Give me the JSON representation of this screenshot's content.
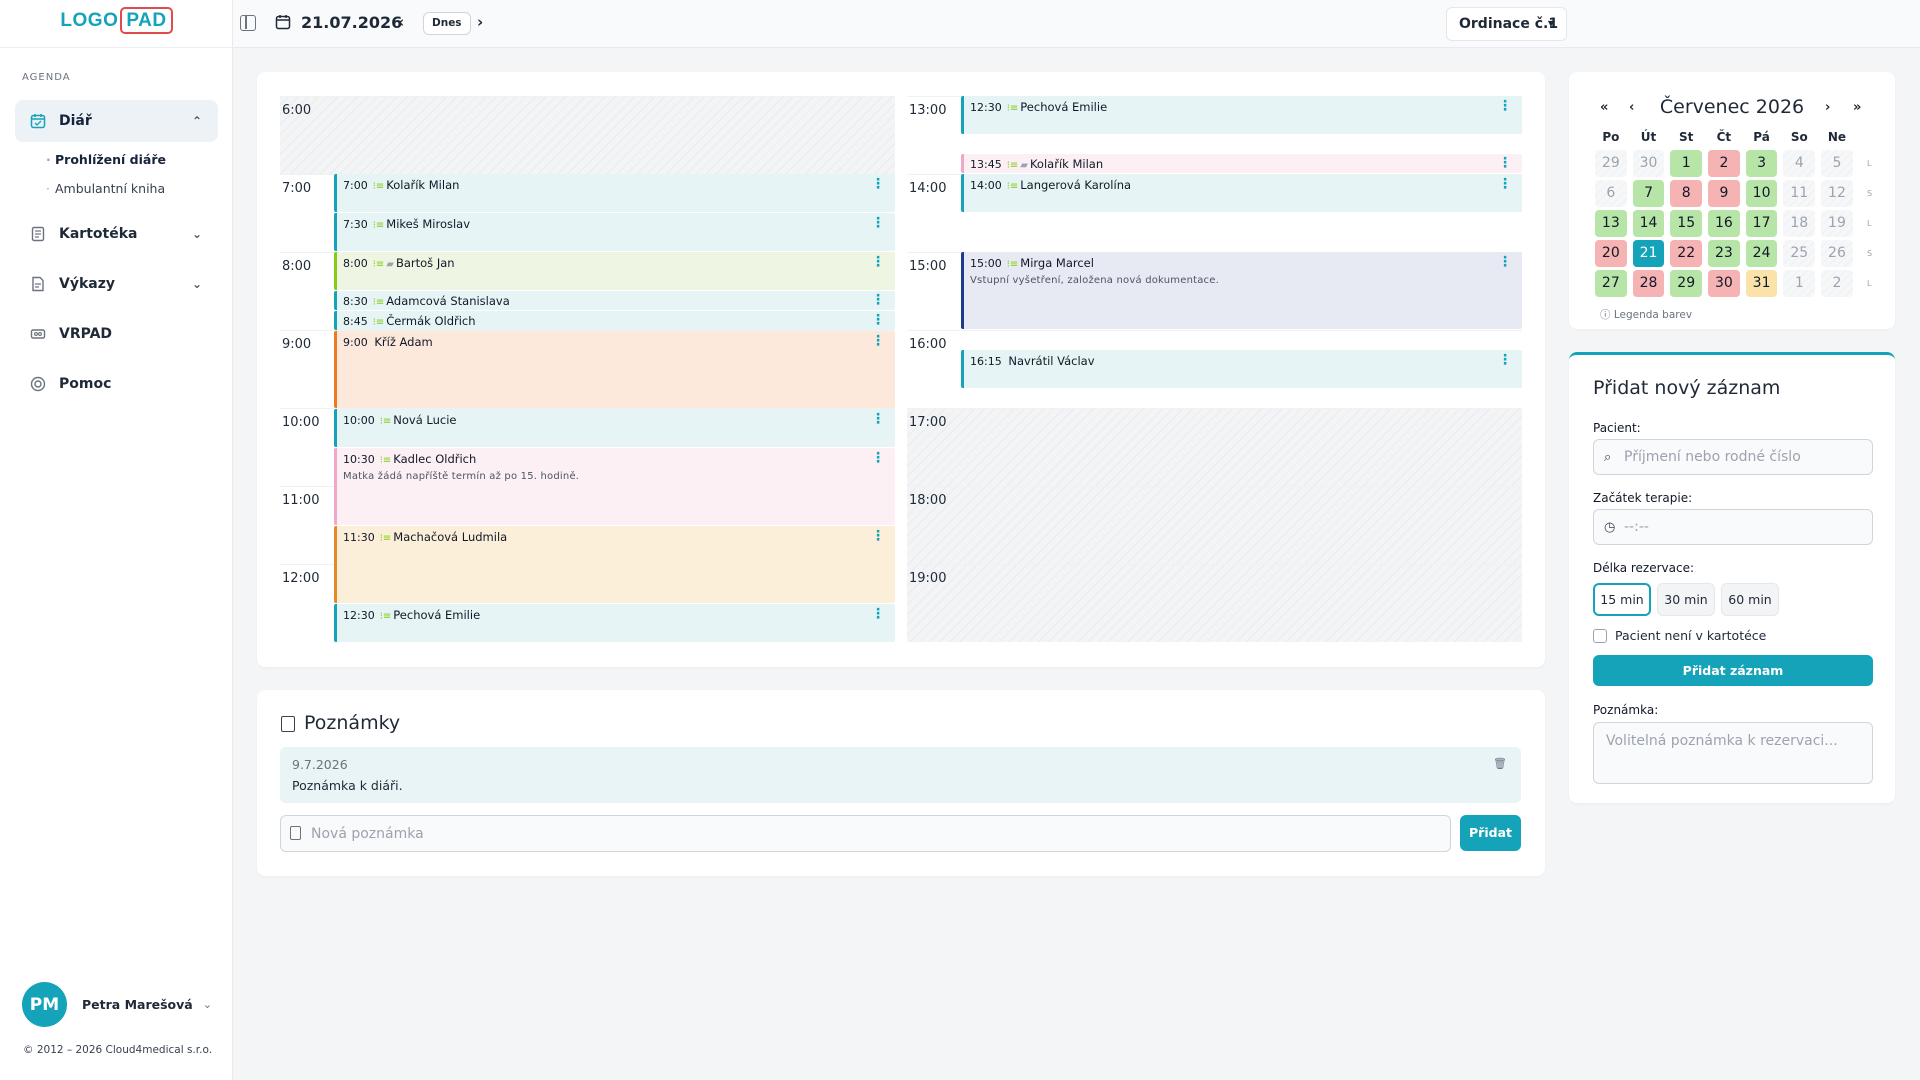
{
  "brand": {
    "part1": "LOGO",
    "part2": "PAD"
  },
  "sidebar": {
    "section": "AGENDA",
    "items": [
      {
        "label": "Diář",
        "icon": "calendar-icon"
      },
      {
        "label": "Kartotéka",
        "icon": "file-cabinet-icon"
      },
      {
        "label": "Výkazy",
        "icon": "report-icon"
      },
      {
        "label": "VRPAD",
        "icon": "card-icon"
      },
      {
        "label": "Pomoc",
        "icon": "lifebuoy-icon"
      }
    ],
    "subitems": [
      "Prohlížení diáře",
      "Ambulantní kniha"
    ],
    "user": {
      "initials": "PM",
      "name": "Petra Marešová"
    },
    "copyright": "© 2012 – 2026 Cloud4medical s.r.o."
  },
  "topbar": {
    "date": "21.07.2026",
    "today": "Dnes",
    "office": "Ordinace č.1"
  },
  "schedule": {
    "left_hours": [
      "6:00",
      "7:00",
      "8:00",
      "9:00",
      "10:00",
      "11:00",
      "12:00"
    ],
    "right_hours": [
      "13:00",
      "14:00",
      "15:00",
      "16:00",
      "17:00",
      "18:00",
      "19:00"
    ],
    "left": [
      {
        "time": "7:00",
        "name": "Kolařík Milan",
        "note": ""
      },
      {
        "time": "7:30",
        "name": "Mikeš Miroslav",
        "note": ""
      },
      {
        "time": "8:00",
        "name": "Bartoš Jan",
        "note": ""
      },
      {
        "time": "8:30",
        "name": "Adamcová Stanislava",
        "note": ""
      },
      {
        "time": "8:45",
        "name": "Čermák Oldřich",
        "note": ""
      },
      {
        "time": "9:00",
        "name": "Kříž Adam",
        "note": ""
      },
      {
        "time": "10:00",
        "name": "Nová Lucie",
        "note": ""
      },
      {
        "time": "10:30",
        "name": "Kadlec Oldřich",
        "note": "Matka žádá napříště termín až po 15. hodině."
      },
      {
        "time": "11:30",
        "name": "Machačová Ludmila",
        "note": ""
      },
      {
        "time": "12:30",
        "name": "Pechová Emilie",
        "note": ""
      }
    ],
    "right": [
      {
        "time": "12:30",
        "name": "Pechová Emilie",
        "note": ""
      },
      {
        "time": "13:45",
        "name": "Kolařík Milan",
        "note": ""
      },
      {
        "time": "14:00",
        "name": "Langerová Karolína",
        "note": ""
      },
      {
        "time": "15:00",
        "name": "Mirga Marcel",
        "note": "Vstupní vyšetření, založena nová dokumentace."
      },
      {
        "time": "16:15",
        "name": "Navrátil Václav",
        "note": ""
      }
    ]
  },
  "notes": {
    "title": "Poznámky",
    "items": [
      {
        "date": "9.7.2026",
        "text": "Poznámka k diáři."
      }
    ],
    "input_placeholder": "Nová poznámka",
    "add_label": "Přidat"
  },
  "minical": {
    "title": "Červenec 2026",
    "nav": {
      "prev_year": "«",
      "prev": "‹",
      "next": "›",
      "next_year": "»"
    },
    "headers": [
      "Po",
      "Út",
      "St",
      "Čt",
      "Pá",
      "So",
      "Ne"
    ],
    "weeks": [
      [
        "29",
        "30",
        "1",
        "2",
        "3",
        "4",
        "5"
      ],
      [
        "6",
        "7",
        "8",
        "9",
        "10",
        "11",
        "12"
      ],
      [
        "13",
        "14",
        "15",
        "16",
        "17",
        "18",
        "19"
      ],
      [
        "20",
        "21",
        "22",
        "23",
        "24",
        "25",
        "26"
      ],
      [
        "27",
        "28",
        "29",
        "30",
        "31",
        "1",
        "2"
      ]
    ],
    "week_marks": [
      "L",
      "S",
      "L",
      "S",
      "L"
    ],
    "legend": "Legenda barev",
    "status_colors": {
      "green": "#b7e5a7",
      "red": "#f6b3b3",
      "yellow": "#fbe2a8",
      "selected": "#14a3b8"
    }
  },
  "form": {
    "title": "Přidat nový záznam",
    "patient_label": "Pacient:",
    "patient_placeholder": "Příjmení nebo rodné číslo",
    "start_label": "Začátek terapie:",
    "start_placeholder": "--:--",
    "duration_label": "Délka rezervace:",
    "durations": [
      "15 min",
      "30 min",
      "60 min"
    ],
    "checkbox_label": "Pacient není v kartotéce",
    "submit": "Přidat záznam",
    "note_label": "Poznámka:",
    "note_placeholder": "Volitelná poznámka k rezervaci..."
  },
  "colors": {
    "accent": "#14a3b8",
    "logo_border": "#e24b4b"
  }
}
